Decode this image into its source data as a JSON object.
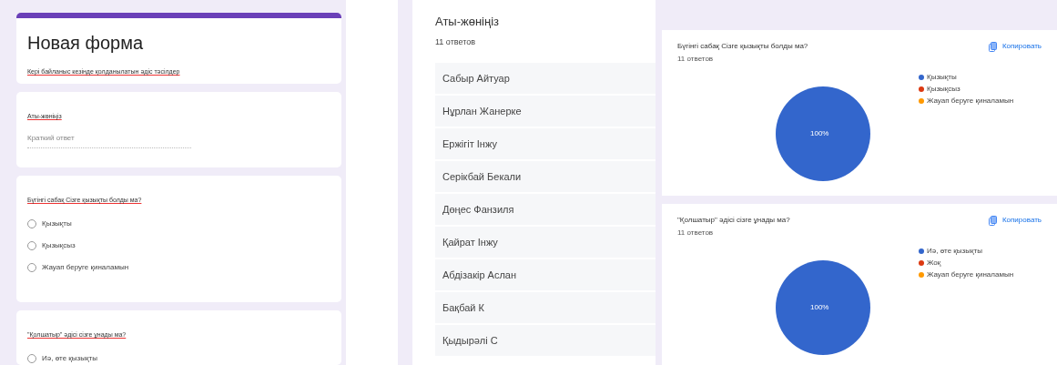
{
  "form": {
    "title": "Новая форма",
    "description": "Кері байланыс кезінде қолданылатын әдіс тәсілдер",
    "questions": [
      {
        "kind": "text",
        "title": "Аты-жөніңіз",
        "placeholder": "Краткий ответ"
      },
      {
        "kind": "radio",
        "title": "Бүгінгі сабақ Сізге қызықты болды ма?",
        "options": [
          {
            "label": "Қызықты",
            "selected": false
          },
          {
            "label": "Қызықсыз",
            "selected": false
          },
          {
            "label": "Жауап беруге қиналамын",
            "selected": false
          }
        ]
      },
      {
        "kind": "radio",
        "title": "\"Қолшатыр\" әдісі сізге ұнады ма?",
        "options": [
          {
            "label": "Иә, өте қызықты",
            "selected": false
          }
        ]
      }
    ]
  },
  "names": {
    "title": "Аты-жөніңіз",
    "count": "11 ответов",
    "answers": [
      "Сабыр Айтуар",
      "Нұрлан Жанерке",
      "Ержігіт Інжу",
      "Серікбай Бекали",
      "Дөңес Фанзиля",
      "Қайрат Інжу",
      "Абдізакір Аслан",
      "Бақбай К",
      "Қыдырәлі С"
    ]
  },
  "summaries": [
    {
      "title": "Бүгінгі сабақ Сізге қызықты болды ма?",
      "count": "11 ответов",
      "copy": "Копировать",
      "chart_data": {
        "type": "pie",
        "categories": [
          "Қызықты",
          "Қызықсыз",
          "Жауап беруге қиналамын"
        ],
        "values": [
          100,
          0,
          0
        ],
        "colors": [
          "#3366cc",
          "#dc3912",
          "#ff9900"
        ],
        "value_labels": [
          "100%",
          null,
          null
        ]
      }
    },
    {
      "title": "\"Қолшатыр\" әдісі сізге ұнады ма?",
      "count": "11 ответов",
      "copy": "Копировать",
      "chart_data": {
        "type": "pie",
        "categories": [
          "Иә, өте қызықты",
          "Жоқ",
          "Жауап беруге қиналамын"
        ],
        "values": [
          100,
          0,
          0
        ],
        "colors": [
          "#3366cc",
          "#dc3912",
          "#ff9900"
        ],
        "value_labels": [
          "100%",
          null,
          null
        ]
      }
    }
  ]
}
